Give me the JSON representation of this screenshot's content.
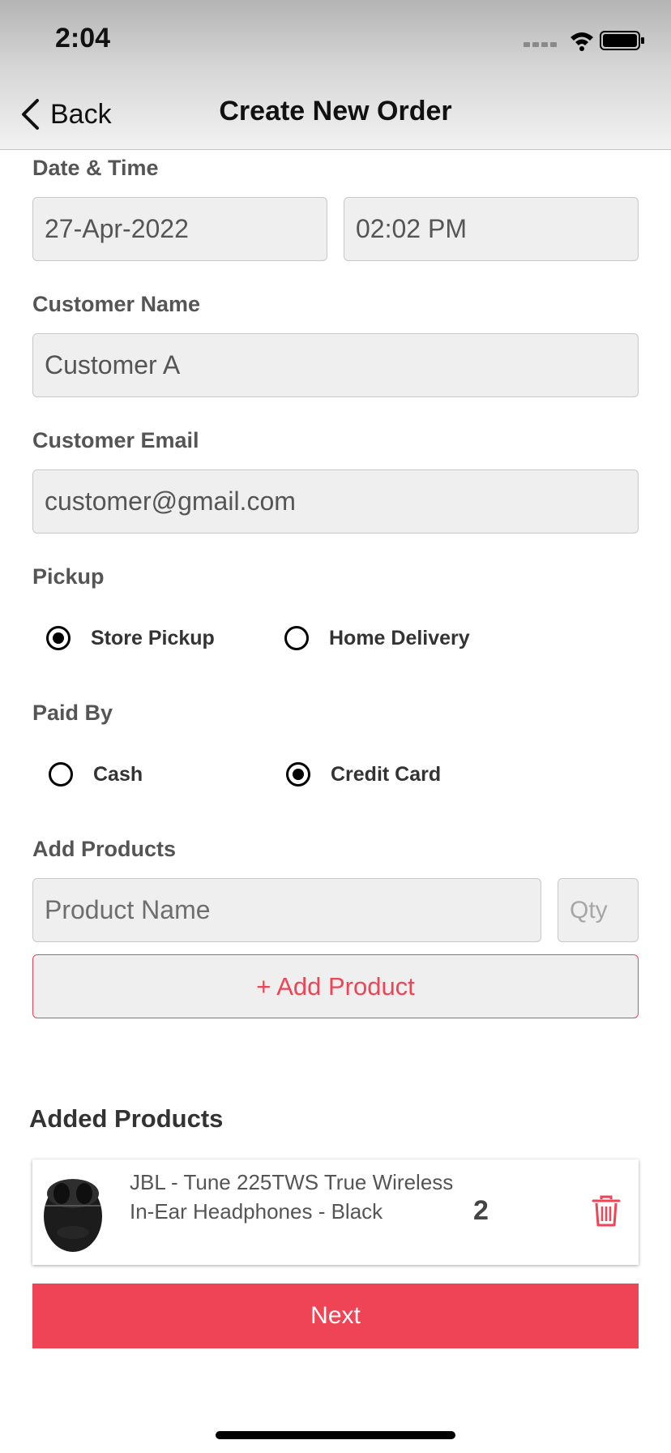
{
  "status_bar": {
    "time": "2:04"
  },
  "nav": {
    "back_label": "Back",
    "title": "Create New Order"
  },
  "form": {
    "date_time_label": "Date & Time",
    "date_value": "27-Apr-2022",
    "time_value": "02:02 PM",
    "customer_name_label": "Customer Name",
    "customer_name_value": "Customer A",
    "customer_email_label": "Customer Email",
    "customer_email_value": "customer@gmail.com",
    "pickup_label": "Pickup",
    "pickup_options": [
      {
        "label": "Store Pickup",
        "selected": true
      },
      {
        "label": "Home Delivery",
        "selected": false
      }
    ],
    "paid_by_label": "Paid By",
    "paid_by_options": [
      {
        "label": "Cash",
        "selected": false
      },
      {
        "label": "Credit Card",
        "selected": true
      }
    ],
    "add_products_label": "Add Products",
    "product_name_placeholder": "Product Name",
    "qty_placeholder": "Qty",
    "add_product_button": "+ Add Product"
  },
  "added_products": {
    "title": "Added Products",
    "items": [
      {
        "name": "JBL - Tune 225TWS True Wireless In-Ear Headphones - Black",
        "qty": "2"
      }
    ]
  },
  "next_button": "Next",
  "colors": {
    "accent": "#ef4455",
    "field_bg": "#efefef"
  }
}
